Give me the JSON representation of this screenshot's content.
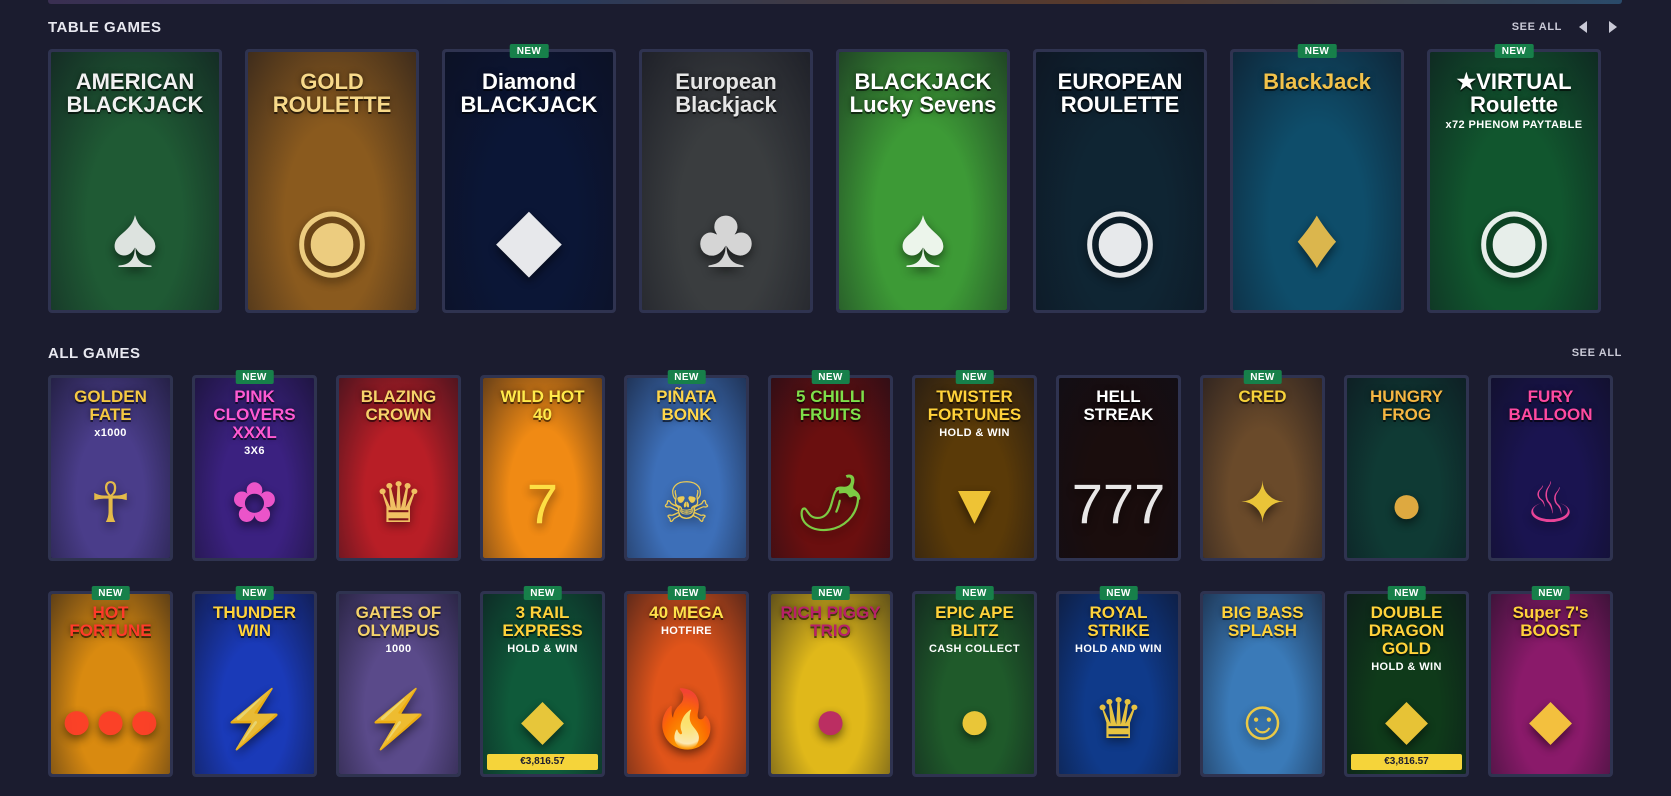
{
  "colors": {
    "background": "#1b1c2f",
    "tile_border": "#2f3350",
    "badge": "#17804a",
    "jackpot": "#f5d43a"
  },
  "sections": {
    "table_games": {
      "title": "TABLE GAMES",
      "see_all": "SEE ALL",
      "prev_icon": "chevron-left-icon",
      "next_icon": "chevron-right-icon",
      "tiles": [
        {
          "name": "American Blackjack",
          "title": "AMERICAN BLACKJACK",
          "new": false,
          "bg": "#1f5a34",
          "fg": "#f2f2f2",
          "icon": "cards-icon",
          "emblem": "♠"
        },
        {
          "name": "Gold Roulette",
          "title": "GOLD ROULETTE",
          "new": false,
          "bg": "#8a5a1e",
          "fg": "#f7d98a",
          "icon": "roulette-wheel-icon",
          "emblem": "◉"
        },
        {
          "name": "Diamond Blackjack",
          "title": "Diamond BLACKJACK",
          "new": true,
          "bg": "#0b1636",
          "fg": "#ffffff",
          "icon": "diamond-icon",
          "emblem": "◆"
        },
        {
          "name": "European Blackjack",
          "title": "European Blackjack",
          "new": false,
          "bg": "#3a3d3f",
          "fg": "#e6e6e6",
          "icon": "cards-icon",
          "emblem": "♣"
        },
        {
          "name": "Blackjack Lucky Sevens",
          "title": "BLACKJACK Lucky Sevens",
          "new": false,
          "bg": "#3d9a36",
          "fg": "#ffffff",
          "icon": "spade-card-icon",
          "emblem": "♠"
        },
        {
          "name": "European Roulette",
          "title": "EUROPEAN ROULETTE",
          "new": false,
          "bg": "#0f2533",
          "fg": "#ffffff",
          "icon": "roulette-wheel-icon",
          "emblem": "◉"
        },
        {
          "name": "BlackJack",
          "title": "BlackJack",
          "new": true,
          "bg": "#0e4d6a",
          "fg": "#f2c24a",
          "icon": "cards-icon",
          "emblem": "♦"
        },
        {
          "name": "Virtual Roulette",
          "title": "★VIRTUAL Roulette",
          "sub": "x72 PHENOM PAYTABLE",
          "new": true,
          "bg": "#11562e",
          "fg": "#ffffff",
          "icon": "roulette-wheel-icon",
          "emblem": "◉"
        }
      ]
    },
    "all_games": {
      "title": "ALL GAMES",
      "see_all": "SEE ALL",
      "row1": [
        {
          "name": "Golden Fate x1000",
          "title": "GOLDEN FATE",
          "sub": "x1000",
          "new": false,
          "bg": "#4a3d8a",
          "fg": "#f5c842",
          "icon": "pharaoh-icon",
          "emblem": "☥"
        },
        {
          "name": "Pink Clovers XXXL 3x6",
          "title": "PINK CLOVERS XXXL",
          "sub": "3X6",
          "new": true,
          "bg": "#3b2180",
          "fg": "#ff5ad2",
          "icon": "clover-icon",
          "emblem": "✿"
        },
        {
          "name": "Blazing Crown",
          "title": "BLAZING CROWN",
          "new": false,
          "bg": "#b81e26",
          "fg": "#f7d26a",
          "icon": "crown-icon",
          "emblem": "♛"
        },
        {
          "name": "Wild Hot 40",
          "title": "WILD HOT 40",
          "new": false,
          "bg": "#f08a14",
          "fg": "#ffe94a",
          "icon": "seven-icon",
          "emblem": "7"
        },
        {
          "name": "Pinata Bonk",
          "title": "PIÑATA BONK",
          "new": true,
          "bg": "#3d6fb8",
          "fg": "#ffd64a",
          "icon": "skeleton-icon",
          "emblem": "☠"
        },
        {
          "name": "5 Chilli Fruits",
          "title": "5 CHILLI FRUITS",
          "new": true,
          "bg": "#6a0f0f",
          "fg": "#7ee04a",
          "icon": "chilli-icon",
          "emblem": "🌶"
        },
        {
          "name": "Twister Fortunes Hold & Win",
          "title": "TWISTER FORTUNES",
          "sub": "HOLD & WIN",
          "new": true,
          "bg": "#5a3a08",
          "fg": "#ffd23a",
          "icon": "tornado-icon",
          "emblem": "▼"
        },
        {
          "name": "Hell Streak",
          "title": "HELL STREAK",
          "new": false,
          "bg": "#1a0d0d",
          "fg": "#ffffff",
          "icon": "seven-icon",
          "emblem": "777"
        },
        {
          "name": "Cred",
          "title": "CRED",
          "new": true,
          "bg": "#6a4a2a",
          "fg": "#f7d23a",
          "icon": "dog-icon",
          "emblem": "✦"
        },
        {
          "name": "Hungry Frog",
          "title": "HUNGRY FROG",
          "new": false,
          "bg": "#0f3a34",
          "fg": "#f5b642",
          "icon": "frog-icon",
          "emblem": "●"
        },
        {
          "name": "Fury Balloon",
          "title": "FURY BALLOON",
          "new": false,
          "bg": "#1a1450",
          "fg": "#ff4aa0",
          "icon": "balloon-icon",
          "emblem": "♨"
        }
      ],
      "row2": [
        {
          "name": "Hot Fortune",
          "title": "HOT FORTUNE",
          "new": true,
          "bg": "#d98a10",
          "fg": "#ff3a2a",
          "icon": "coins-icon",
          "emblem": "●●●"
        },
        {
          "name": "Thunder Win",
          "title": "THUNDER WIN",
          "new": true,
          "bg": "#1a3ab8",
          "fg": "#ffd23a",
          "icon": "coins-icon",
          "emblem": "⚡"
        },
        {
          "name": "Gates of Olympus 1000",
          "title": "GATES OF OLYMPUS",
          "sub": "1000",
          "new": false,
          "bg": "#5a4a8a",
          "fg": "#f5d26a",
          "icon": "zeus-icon",
          "emblem": "⚡"
        },
        {
          "name": "3 Rail Express",
          "title": "3 RAIL EXPRESS",
          "sub": "HOLD & WIN",
          "jackpot": "€3,816.57",
          "new": true,
          "bg": "#0f5a3a",
          "fg": "#ffd23a",
          "icon": "train-icon",
          "emblem": "◆"
        },
        {
          "name": "40 Mega Hotfire",
          "title": "40 MEGA",
          "sub": "HOTFIRE",
          "new": true,
          "bg": "#e0541a",
          "fg": "#ffe14a",
          "icon": "fire-icon",
          "emblem": "🔥"
        },
        {
          "name": "Rich Piggy Trio",
          "title": "RICH PIGGY TRIO",
          "new": true,
          "bg": "#e0b81a",
          "fg": "#b8206a",
          "icon": "piggy-icon",
          "emblem": "●"
        },
        {
          "name": "Epic Ape Blitz",
          "title": "EPIC APE BLITZ",
          "sub": "CASH COLLECT",
          "new": true,
          "bg": "#1f5a2a",
          "fg": "#ffd23a",
          "icon": "gorilla-icon",
          "emblem": "●"
        },
        {
          "name": "Royal Strike",
          "title": "ROYAL STRIKE",
          "sub": "HOLD AND WIN",
          "new": true,
          "bg": "#0f3a8a",
          "fg": "#ffd23a",
          "icon": "crown-icon",
          "emblem": "♛"
        },
        {
          "name": "Big Bass Splash",
          "title": "BIG BASS SPLASH",
          "new": false,
          "bg": "#3a7ab8",
          "fg": "#ffd23a",
          "icon": "fisherman-icon",
          "emblem": "☺"
        },
        {
          "name": "Double Dragon Gold",
          "title": "DOUBLE DRAGON GOLD",
          "sub": "HOLD & WIN",
          "jackpot": "€3,816.57",
          "new": true,
          "bg": "#0f3a1a",
          "fg": "#ffd23a",
          "icon": "dragon-icon",
          "emblem": "◆"
        },
        {
          "name": "Super 7s Boost",
          "title": "Super 7's BOOST",
          "new": true,
          "bg": "#8a1a6a",
          "fg": "#ffd23a",
          "icon": "diamond-icon",
          "emblem": "◆"
        }
      ]
    }
  },
  "badge_label": "NEW"
}
